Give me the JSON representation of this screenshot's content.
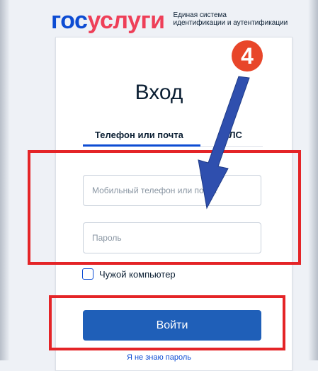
{
  "header": {
    "logo_part1": "гос",
    "logo_part2": "услуги",
    "subtitle_line1": "Единая система",
    "subtitle_line2": "идентификации и аутентификации"
  },
  "form": {
    "title": "Вход",
    "tabs": [
      {
        "label": "Телефон или почта",
        "active": true
      },
      {
        "label": "ИЛС",
        "active": false
      }
    ],
    "login_placeholder": "Мобильный телефон или почта",
    "password_placeholder": "Пароль",
    "checkbox_label": "Чужой компьютер",
    "submit_label": "Войти",
    "forgot_link": "Я не знаю пароль"
  },
  "annotation": {
    "step_number": "4",
    "highlight_color": "#e42427",
    "badge_color": "#e8462a",
    "arrow_color": "#2f4fae"
  },
  "colors": {
    "brand_blue": "#0d4cd3",
    "brand_red": "#ee3f58",
    "button": "#1f5fb8"
  }
}
